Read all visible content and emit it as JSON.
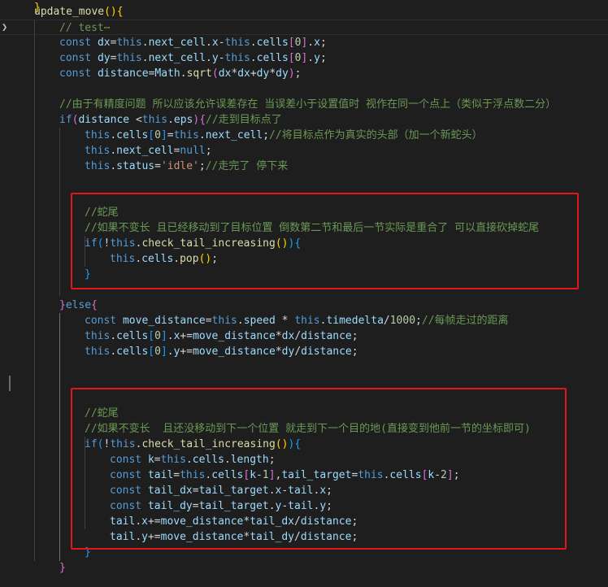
{
  "editor": {
    "lines": [
      [
        {
          "t": "update_move",
          "c": "t-fn"
        },
        {
          "t": "(){",
          "c": "t-brk3"
        }
      ],
      [
        {
          "t": "// test",
          "c": "t-com"
        },
        {
          "t": "⋯",
          "c": "t-com"
        }
      ],
      [
        {
          "t": "const ",
          "c": "t-kw"
        },
        {
          "t": "dx",
          "c": "t-prop"
        },
        {
          "t": "=",
          "c": "t-op"
        },
        {
          "t": "this",
          "c": "t-kw"
        },
        {
          "t": ".",
          "c": "t-op"
        },
        {
          "t": "next_cell",
          "c": "t-prop"
        },
        {
          "t": ".",
          "c": "t-op"
        },
        {
          "t": "x",
          "c": "t-prop"
        },
        {
          "t": "-",
          "c": "t-op"
        },
        {
          "t": "this",
          "c": "t-kw"
        },
        {
          "t": ".",
          "c": "t-op"
        },
        {
          "t": "cells",
          "c": "t-prop"
        },
        {
          "t": "[",
          "c": "t-brk1"
        },
        {
          "t": "0",
          "c": "t-num"
        },
        {
          "t": "]",
          "c": "t-brk1"
        },
        {
          "t": ".",
          "c": "t-op"
        },
        {
          "t": "x",
          "c": "t-prop"
        },
        {
          "t": ";",
          "c": "t-op"
        }
      ],
      [
        {
          "t": "const ",
          "c": "t-kw"
        },
        {
          "t": "dy",
          "c": "t-prop"
        },
        {
          "t": "=",
          "c": "t-op"
        },
        {
          "t": "this",
          "c": "t-kw"
        },
        {
          "t": ".",
          "c": "t-op"
        },
        {
          "t": "next_cell",
          "c": "t-prop"
        },
        {
          "t": ".",
          "c": "t-op"
        },
        {
          "t": "y",
          "c": "t-prop"
        },
        {
          "t": "-",
          "c": "t-op"
        },
        {
          "t": "this",
          "c": "t-kw"
        },
        {
          "t": ".",
          "c": "t-op"
        },
        {
          "t": "cells",
          "c": "t-prop"
        },
        {
          "t": "[",
          "c": "t-brk1"
        },
        {
          "t": "0",
          "c": "t-num"
        },
        {
          "t": "]",
          "c": "t-brk1"
        },
        {
          "t": ".",
          "c": "t-op"
        },
        {
          "t": "y",
          "c": "t-prop"
        },
        {
          "t": ";",
          "c": "t-op"
        }
      ],
      [
        {
          "t": "const ",
          "c": "t-kw"
        },
        {
          "t": "distance",
          "c": "t-prop"
        },
        {
          "t": "=",
          "c": "t-op"
        },
        {
          "t": "Math",
          "c": "t-prop"
        },
        {
          "t": ".",
          "c": "t-op"
        },
        {
          "t": "sqrt",
          "c": "t-fn"
        },
        {
          "t": "(",
          "c": "t-brk1"
        },
        {
          "t": "dx",
          "c": "t-prop"
        },
        {
          "t": "*",
          "c": "t-op"
        },
        {
          "t": "dx",
          "c": "t-prop"
        },
        {
          "t": "+",
          "c": "t-op"
        },
        {
          "t": "dy",
          "c": "t-prop"
        },
        {
          "t": "*",
          "c": "t-op"
        },
        {
          "t": "dy",
          "c": "t-prop"
        },
        {
          "t": ")",
          "c": "t-brk1"
        },
        {
          "t": ";",
          "c": "t-op"
        }
      ],
      [],
      [
        {
          "t": "//由于有精度问题 所以应该允许误差存在 当误差小于设置值时 视作在同一个点上（类似于浮点数二分）",
          "c": "t-com"
        }
      ],
      [
        {
          "t": "if",
          "c": "t-kw"
        },
        {
          "t": "(",
          "c": "t-brk1"
        },
        {
          "t": "distance ",
          "c": "t-prop"
        },
        {
          "t": "<",
          "c": "t-op"
        },
        {
          "t": "this",
          "c": "t-kw"
        },
        {
          "t": ".",
          "c": "t-op"
        },
        {
          "t": "eps",
          "c": "t-prop"
        },
        {
          "t": ")",
          "c": "t-brk1"
        },
        {
          "t": "{",
          "c": "t-brk1"
        },
        {
          "t": "//走到目标点了",
          "c": "t-com"
        }
      ],
      [
        {
          "t": "this",
          "c": "t-kw"
        },
        {
          "t": ".",
          "c": "t-op"
        },
        {
          "t": "cells",
          "c": "t-prop"
        },
        {
          "t": "[",
          "c": "t-brk2"
        },
        {
          "t": "0",
          "c": "t-num"
        },
        {
          "t": "]",
          "c": "t-brk2"
        },
        {
          "t": "=",
          "c": "t-op"
        },
        {
          "t": "this",
          "c": "t-kw"
        },
        {
          "t": ".",
          "c": "t-op"
        },
        {
          "t": "next_cell",
          "c": "t-prop"
        },
        {
          "t": ";",
          "c": "t-op"
        },
        {
          "t": "//将目标点作为真实的头部（加一个新蛇头）",
          "c": "t-com"
        }
      ],
      [
        {
          "t": "this",
          "c": "t-kw"
        },
        {
          "t": ".",
          "c": "t-op"
        },
        {
          "t": "next_cell",
          "c": "t-prop"
        },
        {
          "t": "=",
          "c": "t-op"
        },
        {
          "t": "null",
          "c": "t-kw"
        },
        {
          "t": ";",
          "c": "t-op"
        }
      ],
      [
        {
          "t": "this",
          "c": "t-kw"
        },
        {
          "t": ".",
          "c": "t-op"
        },
        {
          "t": "status",
          "c": "t-prop"
        },
        {
          "t": "=",
          "c": "t-op"
        },
        {
          "t": "'idle'",
          "c": "t-str"
        },
        {
          "t": ";",
          "c": "t-op"
        },
        {
          "t": "//走完了 停下来",
          "c": "t-com"
        }
      ],
      [],
      [],
      [
        {
          "t": "//蛇尾",
          "c": "t-com"
        }
      ],
      [
        {
          "t": "//如果不变长 且已经移动到了目标位置 倒数第二节和最后一节实际是重合了 可以直接砍掉蛇尾",
          "c": "t-com"
        }
      ],
      [
        {
          "t": "if",
          "c": "t-kw"
        },
        {
          "t": "(",
          "c": "t-brk2"
        },
        {
          "t": "!",
          "c": "t-op"
        },
        {
          "t": "this",
          "c": "t-kw"
        },
        {
          "t": ".",
          "c": "t-op"
        },
        {
          "t": "check_tail_increasing",
          "c": "t-fn"
        },
        {
          "t": "()",
          "c": "t-brk3"
        },
        {
          "t": ")",
          "c": "t-brk2"
        },
        {
          "t": "{",
          "c": "t-brk2"
        }
      ],
      [
        {
          "t": "this",
          "c": "t-kw"
        },
        {
          "t": ".",
          "c": "t-op"
        },
        {
          "t": "cells",
          "c": "t-prop"
        },
        {
          "t": ".",
          "c": "t-op"
        },
        {
          "t": "pop",
          "c": "t-fn"
        },
        {
          "t": "()",
          "c": "t-brk3"
        },
        {
          "t": ";",
          "c": "t-op"
        }
      ],
      [
        {
          "t": "}",
          "c": "t-brk2"
        }
      ],
      [],
      [
        {
          "t": "}",
          "c": "t-brk1"
        },
        {
          "t": "else",
          "c": "t-kw"
        },
        {
          "t": "{",
          "c": "t-brk1"
        }
      ],
      [
        {
          "t": "const ",
          "c": "t-kw"
        },
        {
          "t": "move_distance",
          "c": "t-prop"
        },
        {
          "t": "=",
          "c": "t-op"
        },
        {
          "t": "this",
          "c": "t-kw"
        },
        {
          "t": ".",
          "c": "t-op"
        },
        {
          "t": "speed ",
          "c": "t-prop"
        },
        {
          "t": "* ",
          "c": "t-op"
        },
        {
          "t": "this",
          "c": "t-kw"
        },
        {
          "t": ".",
          "c": "t-op"
        },
        {
          "t": "timedelta",
          "c": "t-prop"
        },
        {
          "t": "/",
          "c": "t-op"
        },
        {
          "t": "1000",
          "c": "t-num"
        },
        {
          "t": ";",
          "c": "t-op"
        },
        {
          "t": "//每帧走过的距离",
          "c": "t-com"
        }
      ],
      [
        {
          "t": "this",
          "c": "t-kw"
        },
        {
          "t": ".",
          "c": "t-op"
        },
        {
          "t": "cells",
          "c": "t-prop"
        },
        {
          "t": "[",
          "c": "t-brk2"
        },
        {
          "t": "0",
          "c": "t-num"
        },
        {
          "t": "]",
          "c": "t-brk2"
        },
        {
          "t": ".",
          "c": "t-op"
        },
        {
          "t": "x",
          "c": "t-prop"
        },
        {
          "t": "+=",
          "c": "t-op"
        },
        {
          "t": "move_distance",
          "c": "t-prop"
        },
        {
          "t": "*",
          "c": "t-op"
        },
        {
          "t": "dx",
          "c": "t-prop"
        },
        {
          "t": "/",
          "c": "t-op"
        },
        {
          "t": "distance",
          "c": "t-prop"
        },
        {
          "t": ";",
          "c": "t-op"
        }
      ],
      [
        {
          "t": "this",
          "c": "t-kw"
        },
        {
          "t": ".",
          "c": "t-op"
        },
        {
          "t": "cells",
          "c": "t-prop"
        },
        {
          "t": "[",
          "c": "t-brk2"
        },
        {
          "t": "0",
          "c": "t-num"
        },
        {
          "t": "]",
          "c": "t-brk2"
        },
        {
          "t": ".",
          "c": "t-op"
        },
        {
          "t": "y",
          "c": "t-prop"
        },
        {
          "t": "+=",
          "c": "t-op"
        },
        {
          "t": "move_distance",
          "c": "t-prop"
        },
        {
          "t": "*",
          "c": "t-op"
        },
        {
          "t": "dy",
          "c": "t-prop"
        },
        {
          "t": "/",
          "c": "t-op"
        },
        {
          "t": "distance",
          "c": "t-prop"
        },
        {
          "t": ";",
          "c": "t-op"
        }
      ],
      [],
      [],
      [],
      [
        {
          "t": "//蛇尾",
          "c": "t-com"
        }
      ],
      [
        {
          "t": "//如果不变长  且还没移动到下一个位置 就走到下一个目的地(直接变到他前一节的坐标即可)",
          "c": "t-com"
        }
      ],
      [
        {
          "t": "if",
          "c": "t-kw"
        },
        {
          "t": "(",
          "c": "t-brk2"
        },
        {
          "t": "!",
          "c": "t-op"
        },
        {
          "t": "this",
          "c": "t-kw"
        },
        {
          "t": ".",
          "c": "t-op"
        },
        {
          "t": "check_tail_increasing",
          "c": "t-fn"
        },
        {
          "t": "()",
          "c": "t-brk3"
        },
        {
          "t": ")",
          "c": "t-brk2"
        },
        {
          "t": "{",
          "c": "t-brk2"
        }
      ],
      [
        {
          "t": "const ",
          "c": "t-kw"
        },
        {
          "t": "k",
          "c": "t-prop"
        },
        {
          "t": "=",
          "c": "t-op"
        },
        {
          "t": "this",
          "c": "t-kw"
        },
        {
          "t": ".",
          "c": "t-op"
        },
        {
          "t": "cells",
          "c": "t-prop"
        },
        {
          "t": ".",
          "c": "t-op"
        },
        {
          "t": "length",
          "c": "t-prop"
        },
        {
          "t": ";",
          "c": "t-op"
        }
      ],
      [
        {
          "t": "const ",
          "c": "t-kw"
        },
        {
          "t": "tail",
          "c": "t-prop"
        },
        {
          "t": "=",
          "c": "t-op"
        },
        {
          "t": "this",
          "c": "t-kw"
        },
        {
          "t": ".",
          "c": "t-op"
        },
        {
          "t": "cells",
          "c": "t-prop"
        },
        {
          "t": "[",
          "c": "t-brk1"
        },
        {
          "t": "k",
          "c": "t-prop"
        },
        {
          "t": "-",
          "c": "t-op"
        },
        {
          "t": "1",
          "c": "t-num"
        },
        {
          "t": "]",
          "c": "t-brk1"
        },
        {
          "t": ",",
          "c": "t-op"
        },
        {
          "t": "tail_target",
          "c": "t-prop"
        },
        {
          "t": "=",
          "c": "t-op"
        },
        {
          "t": "this",
          "c": "t-kw"
        },
        {
          "t": ".",
          "c": "t-op"
        },
        {
          "t": "cells",
          "c": "t-prop"
        },
        {
          "t": "[",
          "c": "t-brk1"
        },
        {
          "t": "k",
          "c": "t-prop"
        },
        {
          "t": "-",
          "c": "t-op"
        },
        {
          "t": "2",
          "c": "t-num"
        },
        {
          "t": "]",
          "c": "t-brk1"
        },
        {
          "t": ";",
          "c": "t-op"
        }
      ],
      [
        {
          "t": "const ",
          "c": "t-kw"
        },
        {
          "t": "tail_dx",
          "c": "t-prop"
        },
        {
          "t": "=",
          "c": "t-op"
        },
        {
          "t": "tail_target",
          "c": "t-prop"
        },
        {
          "t": ".",
          "c": "t-op"
        },
        {
          "t": "x",
          "c": "t-prop"
        },
        {
          "t": "-",
          "c": "t-op"
        },
        {
          "t": "tail",
          "c": "t-prop"
        },
        {
          "t": ".",
          "c": "t-op"
        },
        {
          "t": "x",
          "c": "t-prop"
        },
        {
          "t": ";",
          "c": "t-op"
        }
      ],
      [
        {
          "t": "const ",
          "c": "t-kw"
        },
        {
          "t": "tail_dy",
          "c": "t-prop"
        },
        {
          "t": "=",
          "c": "t-op"
        },
        {
          "t": "tail_target",
          "c": "t-prop"
        },
        {
          "t": ".",
          "c": "t-op"
        },
        {
          "t": "y",
          "c": "t-prop"
        },
        {
          "t": "-",
          "c": "t-op"
        },
        {
          "t": "tail",
          "c": "t-prop"
        },
        {
          "t": ".",
          "c": "t-op"
        },
        {
          "t": "y",
          "c": "t-prop"
        },
        {
          "t": ";",
          "c": "t-op"
        }
      ],
      [
        {
          "t": "tail",
          "c": "t-prop"
        },
        {
          "t": ".",
          "c": "t-op"
        },
        {
          "t": "x",
          "c": "t-prop"
        },
        {
          "t": "+=",
          "c": "t-op"
        },
        {
          "t": "move_distance",
          "c": "t-prop"
        },
        {
          "t": "*",
          "c": "t-op"
        },
        {
          "t": "tail_dx",
          "c": "t-prop"
        },
        {
          "t": "/",
          "c": "t-op"
        },
        {
          "t": "distance",
          "c": "t-prop"
        },
        {
          "t": ";",
          "c": "t-op"
        }
      ],
      [
        {
          "t": "tail",
          "c": "t-prop"
        },
        {
          "t": ".",
          "c": "t-op"
        },
        {
          "t": "y",
          "c": "t-prop"
        },
        {
          "t": "+=",
          "c": "t-op"
        },
        {
          "t": "move_distance",
          "c": "t-prop"
        },
        {
          "t": "*",
          "c": "t-op"
        },
        {
          "t": "tail_dy",
          "c": "t-prop"
        },
        {
          "t": "/",
          "c": "t-op"
        },
        {
          "t": "distance",
          "c": "t-prop"
        },
        {
          "t": ";",
          "c": "t-op"
        }
      ],
      [
        {
          "t": "}",
          "c": "t-brk2"
        }
      ],
      [
        {
          "t": "}",
          "c": "t-brk1"
        }
      ],
      [
        {
          "t": "}",
          "c": "t-brk3"
        }
      ]
    ],
    "colors": {
      "background": "#1e1e1e",
      "keyword": "#569cd6",
      "function": "#dcdcaa",
      "property": "#9cdcfe",
      "number": "#b5cea8",
      "string": "#ce9178",
      "comment": "#6a9955",
      "highlight_box": "#e5151a"
    },
    "icons": {
      "fold": "chevron-right-icon"
    }
  }
}
